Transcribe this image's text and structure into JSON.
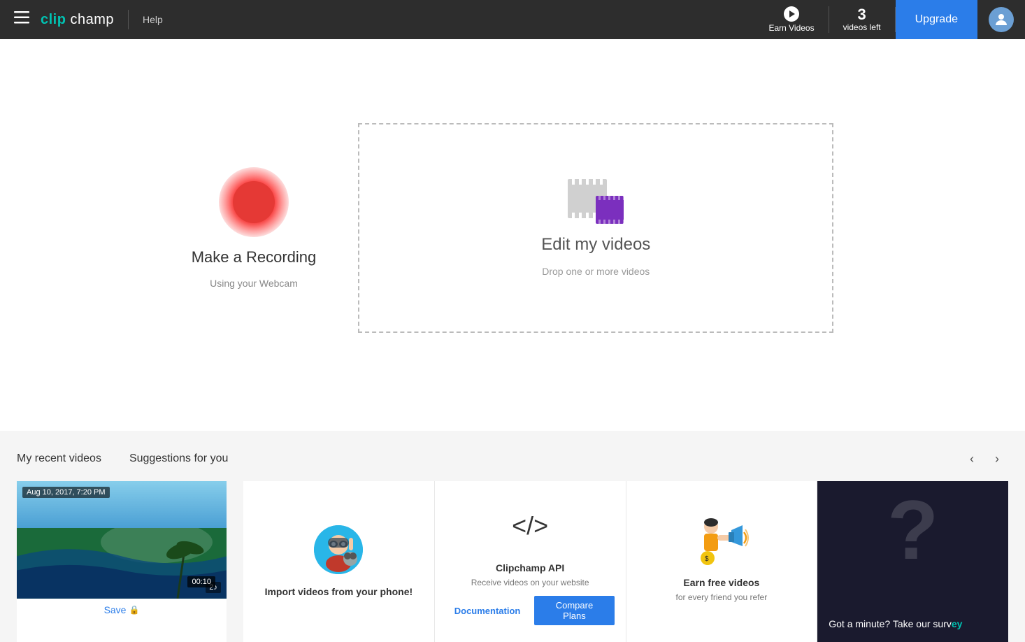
{
  "header": {
    "menu_label": "Menu",
    "logo_clip": "clip",
    "logo_champ": "champ",
    "help_label": "Help",
    "earn_videos_label": "Earn Videos",
    "videos_left_count": "3",
    "videos_left_label": "videos left",
    "upgrade_label": "Upgrade"
  },
  "main": {
    "record": {
      "title": "Make a Recording",
      "subtitle": "Using your Webcam"
    },
    "edit": {
      "title": "Edit my videos",
      "subtitle": "Drop one or more videos"
    }
  },
  "bottom": {
    "recent_title": "My recent videos",
    "suggestions_title": "Suggestions for you",
    "recent_video": {
      "timestamp": "Aug 10, 2017, 7:20 PM",
      "duration": "00:10",
      "badge": "2♪",
      "save_label": "Save"
    },
    "suggestions": [
      {
        "id": "phone-import",
        "title": "Import videos from your phone!",
        "subtitle": "",
        "buttons": []
      },
      {
        "id": "clipchamp-api",
        "title": "Clipchamp API",
        "subtitle": "Receive videos on your website",
        "btn_outline": "Documentation",
        "btn_filled": "Compare Plans"
      },
      {
        "id": "earn-free-videos",
        "title": "Earn free videos",
        "subtitle": "for every friend you refer",
        "buttons": []
      },
      {
        "id": "survey",
        "title": "Got a minute? Take our surv",
        "subtitle": "",
        "buttons": []
      }
    ],
    "nav_prev": "‹",
    "nav_next": "›"
  },
  "colors": {
    "accent_blue": "#2b7de9",
    "accent_teal": "#00c2b2",
    "header_bg": "#2d2d2d",
    "record_red": "#e53935",
    "film_purple": "#7b2fbe"
  }
}
